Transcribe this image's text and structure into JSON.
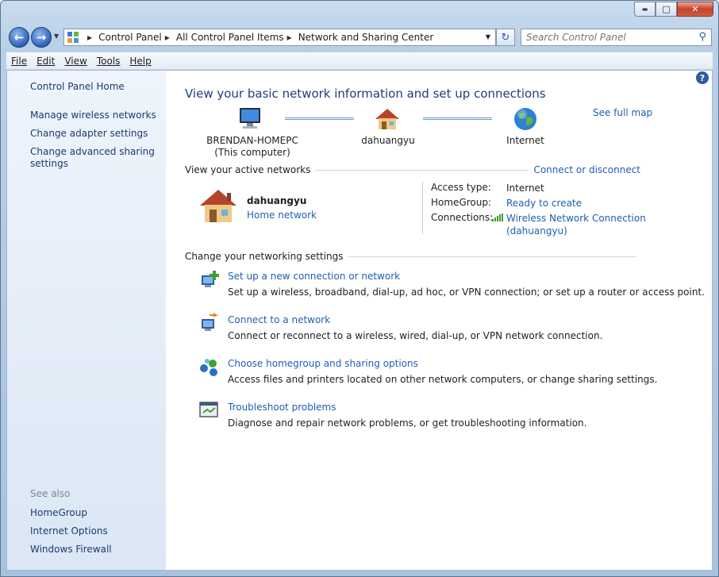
{
  "window": {
    "minimize_glyph": "▬",
    "maximize_glyph": "□",
    "close_glyph": "✕"
  },
  "address_bar": {
    "breadcrumbs": [
      "Control Panel",
      "All Control Panel Items",
      "Network and Sharing Center"
    ],
    "search_placeholder": "Search Control Panel"
  },
  "menu": [
    "File",
    "Edit",
    "View",
    "Tools",
    "Help"
  ],
  "sidebar": {
    "home": "Control Panel Home",
    "links": [
      "Manage wireless networks",
      "Change adapter settings",
      "Change advanced sharing settings"
    ],
    "see_also_label": "See also",
    "see_also": [
      "HomeGroup",
      "Internet Options",
      "Windows Firewall"
    ]
  },
  "main": {
    "heading": "View your basic network information and set up connections",
    "see_full_map": "See full map",
    "map": {
      "computer_name": "BRENDAN-HOMEPC",
      "computer_sub": "(This computer)",
      "network": "dahuangyu",
      "internet": "Internet"
    },
    "active_networks": {
      "label": "View your active networks",
      "action": "Connect or disconnect",
      "network_name": "dahuangyu",
      "network_category": "Home network",
      "access_type_label": "Access type:",
      "access_type_value": "Internet",
      "homegroup_label": "HomeGroup:",
      "homegroup_value": "Ready to create",
      "connections_label": "Connections:",
      "connections_value_line1": "Wireless Network Connection",
      "connections_value_line2": "(dahuangyu)"
    },
    "settings_label": "Change your networking settings",
    "tasks": [
      {
        "title": "Set up a new connection or network",
        "desc": "Set up a wireless, broadband, dial-up, ad hoc, or VPN connection; or set up a router or access point."
      },
      {
        "title": "Connect to a network",
        "desc": "Connect or reconnect to a wireless, wired, dial-up, or VPN network connection."
      },
      {
        "title": "Choose homegroup and sharing options",
        "desc": "Access files and printers located on other network computers, or change sharing settings."
      },
      {
        "title": "Troubleshoot problems",
        "desc": "Diagnose and repair network problems, or get troubleshooting information."
      }
    ]
  },
  "colors": {
    "link": "#1f5fb3",
    "heading": "#1e3d7d",
    "sidebar_bg": "#e4edf8"
  }
}
